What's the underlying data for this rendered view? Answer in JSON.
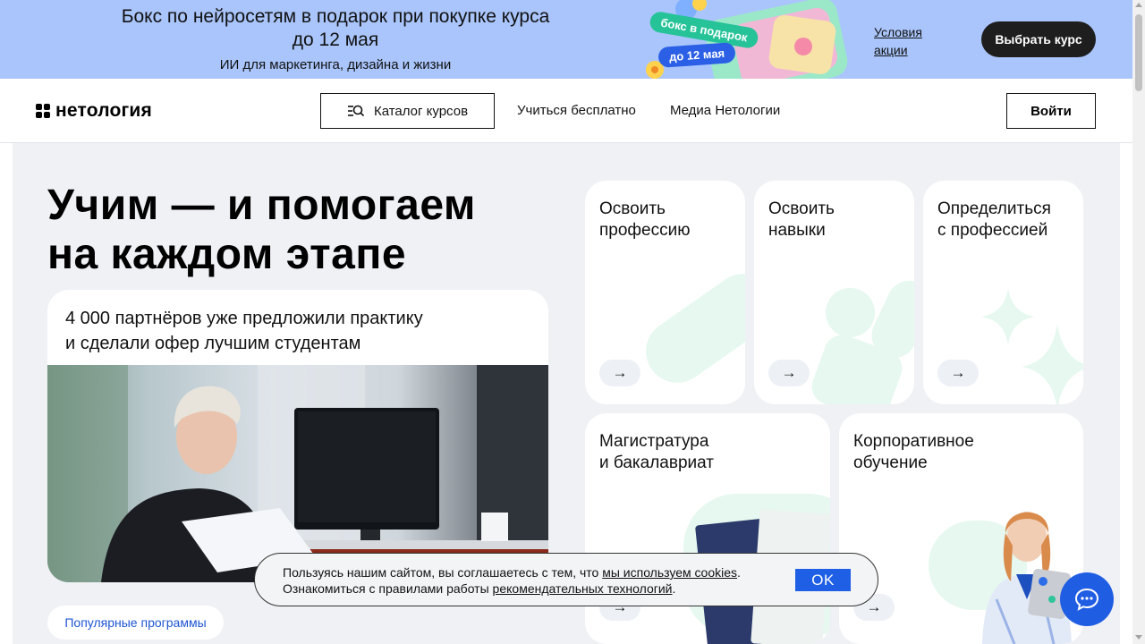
{
  "promo": {
    "title_line1": "Бокс по нейросетям в подарок при покупке курса",
    "title_line2": "до 12 мая",
    "subtitle": "ИИ для маркетинга, дизайна и жизни",
    "sticker_box": "бокс в подарок",
    "sticker_date": "до 12 мая",
    "conditions_line1": "Условия",
    "conditions_line2": "акции",
    "cta": "Выбрать курс"
  },
  "header": {
    "logo": "нетология",
    "catalog": "Каталог курсов",
    "nav": [
      "Учиться бесплатно",
      "Медиа Нетологии"
    ],
    "login": "Войти"
  },
  "hero": {
    "title_line1": "Учим — и помогаем",
    "title_line2": "на каждом этапе",
    "partners_line1": "4 000 партнёров уже предложили практику",
    "partners_line2": "и сделали офер лучшим студентам",
    "popular": "Популярные программы"
  },
  "cards": [
    {
      "line1": "Освоить",
      "line2": "профессию"
    },
    {
      "line1": "Освоить",
      "line2": "навыки"
    },
    {
      "line1": "Определиться",
      "line2": "с профессией"
    },
    {
      "line1": "Магистратура",
      "line2": "и бакалавриат"
    },
    {
      "line1": "Корпоративное",
      "line2": "обучение"
    }
  ],
  "arrow_glyph": "→",
  "cookie": {
    "line1_pre": "Пользуясь нашим сайтом, вы соглашаетесь с тем, что ",
    "line1_link": "мы используем cookies",
    "line1_post": ".",
    "line2_pre": "Ознакомиться с правилами работы ",
    "line2_link": "рекомендательных технологий",
    "line2_post": ".",
    "ok": "OK"
  },
  "colors": {
    "promo_bg": "#a9c5fb",
    "accent_blue": "#1f5de3",
    "mint": "#e6f8ef",
    "page_bg": "#eff1f5"
  },
  "icons": [
    "catalog-search-icon",
    "arrow-right-icon",
    "chat-icon",
    "logo-icon"
  ]
}
